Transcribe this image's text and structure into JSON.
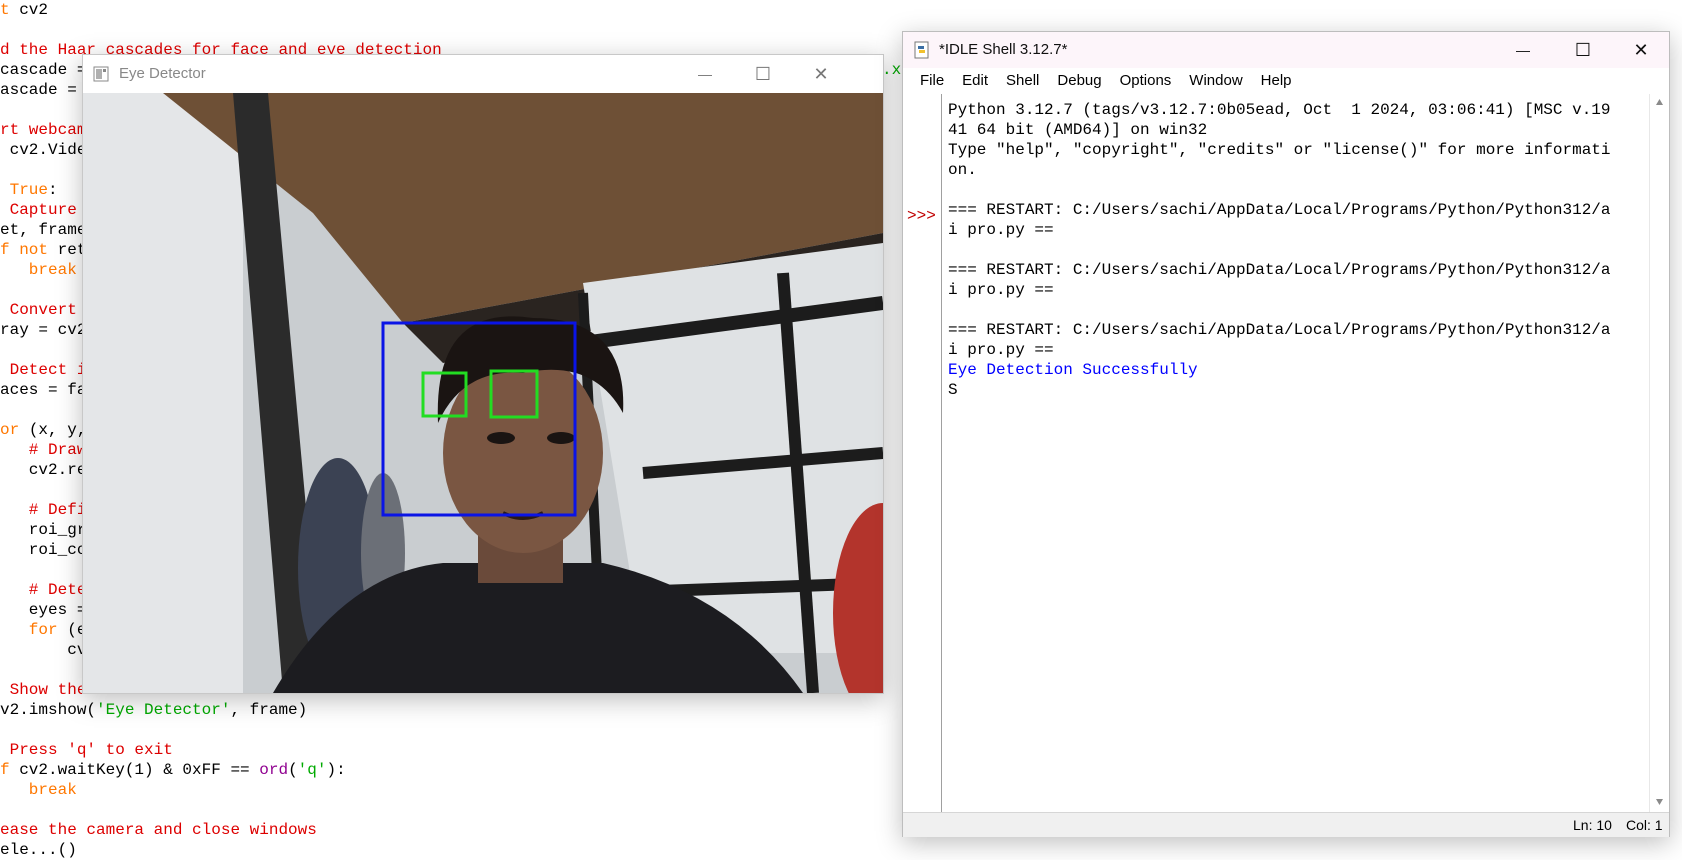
{
  "background_editor": {
    "lines": [
      {
        "segments": [
          {
            "t": "t ",
            "c": "orange"
          },
          {
            "t": "cv2",
            "c": "black"
          }
        ]
      },
      {
        "segments": []
      },
      {
        "segments": [
          {
            "t": "d the Haar cascades for face and eye detection",
            "c": "red"
          }
        ]
      },
      {
        "segments": [
          {
            "t": "cascade = ",
            "c": "black"
          }
        ]
      },
      {
        "segments": [
          {
            "t": "ascade = ",
            "c": "black"
          }
        ]
      },
      {
        "segments": []
      },
      {
        "segments": [
          {
            "t": "rt webcam",
            "c": "red"
          }
        ]
      },
      {
        "segments": [
          {
            "t": " cv2.Vide",
            "c": "black"
          }
        ]
      },
      {
        "segments": []
      },
      {
        "segments": [
          {
            "t": " True",
            "c": "orange"
          },
          {
            "t": ":",
            "c": "black"
          }
        ]
      },
      {
        "segments": [
          {
            "t": " Capture",
            "c": "red"
          }
        ]
      },
      {
        "segments": [
          {
            "t": "et, frame",
            "c": "black"
          }
        ]
      },
      {
        "segments": [
          {
            "t": "f not ",
            "c": "orange"
          },
          {
            "t": "ret",
            "c": "black"
          }
        ]
      },
      {
        "segments": [
          {
            "t": "   break",
            "c": "orange"
          }
        ]
      },
      {
        "segments": []
      },
      {
        "segments": [
          {
            "t": " Convert",
            "c": "red"
          }
        ]
      },
      {
        "segments": [
          {
            "t": "ray = cv2",
            "c": "black"
          }
        ]
      },
      {
        "segments": []
      },
      {
        "segments": [
          {
            "t": " Detect i",
            "c": "red"
          }
        ]
      },
      {
        "segments": [
          {
            "t": "aces = fa",
            "c": "black"
          }
        ]
      },
      {
        "segments": []
      },
      {
        "segments": [
          {
            "t": "or ",
            "c": "orange"
          },
          {
            "t": "(x, y,",
            "c": "black"
          }
        ]
      },
      {
        "segments": [
          {
            "t": "   # Draw",
            "c": "red"
          }
        ]
      },
      {
        "segments": [
          {
            "t": "   cv2.re",
            "c": "black"
          }
        ]
      },
      {
        "segments": []
      },
      {
        "segments": [
          {
            "t": "   # Defi",
            "c": "red"
          }
        ]
      },
      {
        "segments": [
          {
            "t": "   roi_gr",
            "c": "black"
          }
        ]
      },
      {
        "segments": [
          {
            "t": "   roi_co",
            "c": "black"
          }
        ]
      },
      {
        "segments": []
      },
      {
        "segments": [
          {
            "t": "   # Dete",
            "c": "red"
          }
        ]
      },
      {
        "segments": [
          {
            "t": "   eyes =",
            "c": "black"
          }
        ]
      },
      {
        "segments": [
          {
            "t": "   for ",
            "c": "orange"
          },
          {
            "t": "(e",
            "c": "black"
          }
        ]
      },
      {
        "segments": [
          {
            "t": "       cv",
            "c": "black"
          }
        ]
      },
      {
        "segments": []
      },
      {
        "segments": [
          {
            "t": " Show the frame",
            "c": "red"
          }
        ]
      },
      {
        "segments": [
          {
            "t": "v2.imshow(",
            "c": "black"
          },
          {
            "t": "'Eye Detector'",
            "c": "green"
          },
          {
            "t": ", frame)",
            "c": "black"
          }
        ]
      },
      {
        "segments": []
      },
      {
        "segments": [
          {
            "t": " Press 'q' to exit",
            "c": "red"
          }
        ]
      },
      {
        "segments": [
          {
            "t": "f ",
            "c": "orange"
          },
          {
            "t": "cv2.waitKey(1) & 0xFF == ",
            "c": "black"
          },
          {
            "t": "ord",
            "c": "purple"
          },
          {
            "t": "(",
            "c": "black"
          },
          {
            "t": "'q'",
            "c": "green"
          },
          {
            "t": "):",
            "c": "black"
          }
        ]
      },
      {
        "segments": [
          {
            "t": "   break",
            "c": "orange"
          }
        ]
      },
      {
        "segments": []
      },
      {
        "segments": [
          {
            "t": "ease the camera and close windows",
            "c": "red"
          }
        ]
      },
      {
        "segments": [
          {
            "t": "ele...()",
            "c": "black"
          }
        ]
      }
    ],
    "peek_text": ".xr"
  },
  "eye_window": {
    "title": "Eye Detector",
    "minimize": "—",
    "maximize": "☐",
    "close": "✕"
  },
  "idle": {
    "title": "*IDLE Shell 3.12.7*",
    "menu": [
      "File",
      "Edit",
      "Shell",
      "Debug",
      "Options",
      "Window",
      "Help"
    ],
    "prompt": ">>>",
    "lines": [
      {
        "text": "Python 3.12.7 (tags/v3.12.7:0b05ead, Oct  1 2024, 03:06:41) [MSC v.19",
        "style": "normal"
      },
      {
        "text": "41 64 bit (AMD64)] on win32",
        "style": "normal"
      },
      {
        "text": "Type \"help\", \"copyright\", \"credits\" or \"license()\" for more informati",
        "style": "normal"
      },
      {
        "text": "on.",
        "style": "normal"
      },
      {
        "text": "",
        "style": "normal"
      },
      {
        "text": "=== RESTART: C:/Users/sachi/AppData/Local/Programs/Python/Python312/a",
        "style": "normal"
      },
      {
        "text": "i pro.py ==",
        "style": "normal"
      },
      {
        "text": "",
        "style": "normal"
      },
      {
        "text": "=== RESTART: C:/Users/sachi/AppData/Local/Programs/Python/Python312/a",
        "style": "normal"
      },
      {
        "text": "i pro.py ==",
        "style": "normal"
      },
      {
        "text": "",
        "style": "normal"
      },
      {
        "text": "=== RESTART: C:/Users/sachi/AppData/Local/Programs/Python/Python312/a",
        "style": "normal"
      },
      {
        "text": "i pro.py ==",
        "style": "normal"
      },
      {
        "text": "Eye Detection Successfully",
        "style": "blue"
      },
      {
        "text": "S",
        "style": "normal"
      }
    ],
    "status": {
      "line": "Ln: 10",
      "col": "Col: 1"
    }
  },
  "colors": {
    "face_box": "#0a14e6",
    "eye_box": "#22dd22",
    "code_red": "#dd0000",
    "code_orange": "#ff7700",
    "code_green": "#00aa00",
    "code_purple": "#900090",
    "shell_blue": "#0000ff"
  }
}
